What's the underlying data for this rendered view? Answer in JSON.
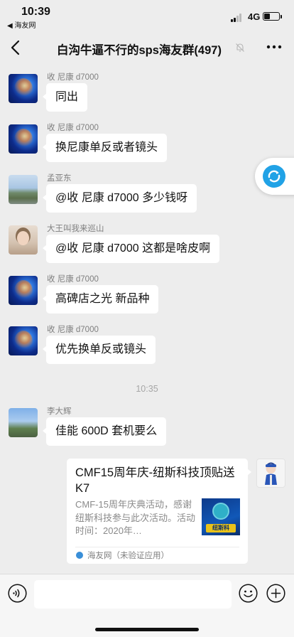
{
  "status_bar": {
    "time": "10:39",
    "back_app": "◀ 海友网",
    "network": "4G",
    "battery_level": 0.3
  },
  "nav": {
    "title": "白沟牛逼不行的sps海友群(497)",
    "back_icon": "chevron-left-icon",
    "mute_icon": "bell-off-icon",
    "more_icon": "more-horizontal-icon"
  },
  "messages": [
    {
      "sender": "收 尼康 d7000",
      "text": "同出",
      "avatar": "nikon-avatar"
    },
    {
      "sender": "收 尼康 d7000",
      "text": "换尼康单反或者镜头",
      "avatar": "nikon-avatar"
    },
    {
      "sender": "孟亚东",
      "text": "@收 尼康 d7000 多少钱呀",
      "avatar": "landscape-avatar"
    },
    {
      "sender": "大王叫我来巡山",
      "text": "@收 尼康 d7000 这都是啥皮啊",
      "avatar": "girl-avatar"
    },
    {
      "sender": "收 尼康 d7000",
      "text": "高碑店之光 新品种",
      "avatar": "nikon-avatar"
    },
    {
      "sender": "收 尼康 d7000",
      "text": "优先换单反或镜头",
      "avatar": "nikon-avatar"
    }
  ],
  "timestamp": "10:35",
  "message_after": {
    "sender": "李大辉",
    "text": "佳能 600D 套机要么",
    "avatar": "sky-avatar"
  },
  "link_card": {
    "title": "CMF15周年庆-纽斯科技顶贴送K7",
    "description": "CMF-15周年庆典活动，感谢纽斯科技参与此次活动。活动时间：2020年…",
    "thumb_text": "纽斯科",
    "source": "海友网（未验证应用）"
  },
  "input_bar": {
    "voice_icon": "voice-icon",
    "emoji_icon": "emoji-icon",
    "plus_icon": "plus-icon",
    "placeholder": ""
  },
  "colors": {
    "background": "#ededed",
    "bubble": "#ffffff",
    "accent": "#21a2e6"
  }
}
